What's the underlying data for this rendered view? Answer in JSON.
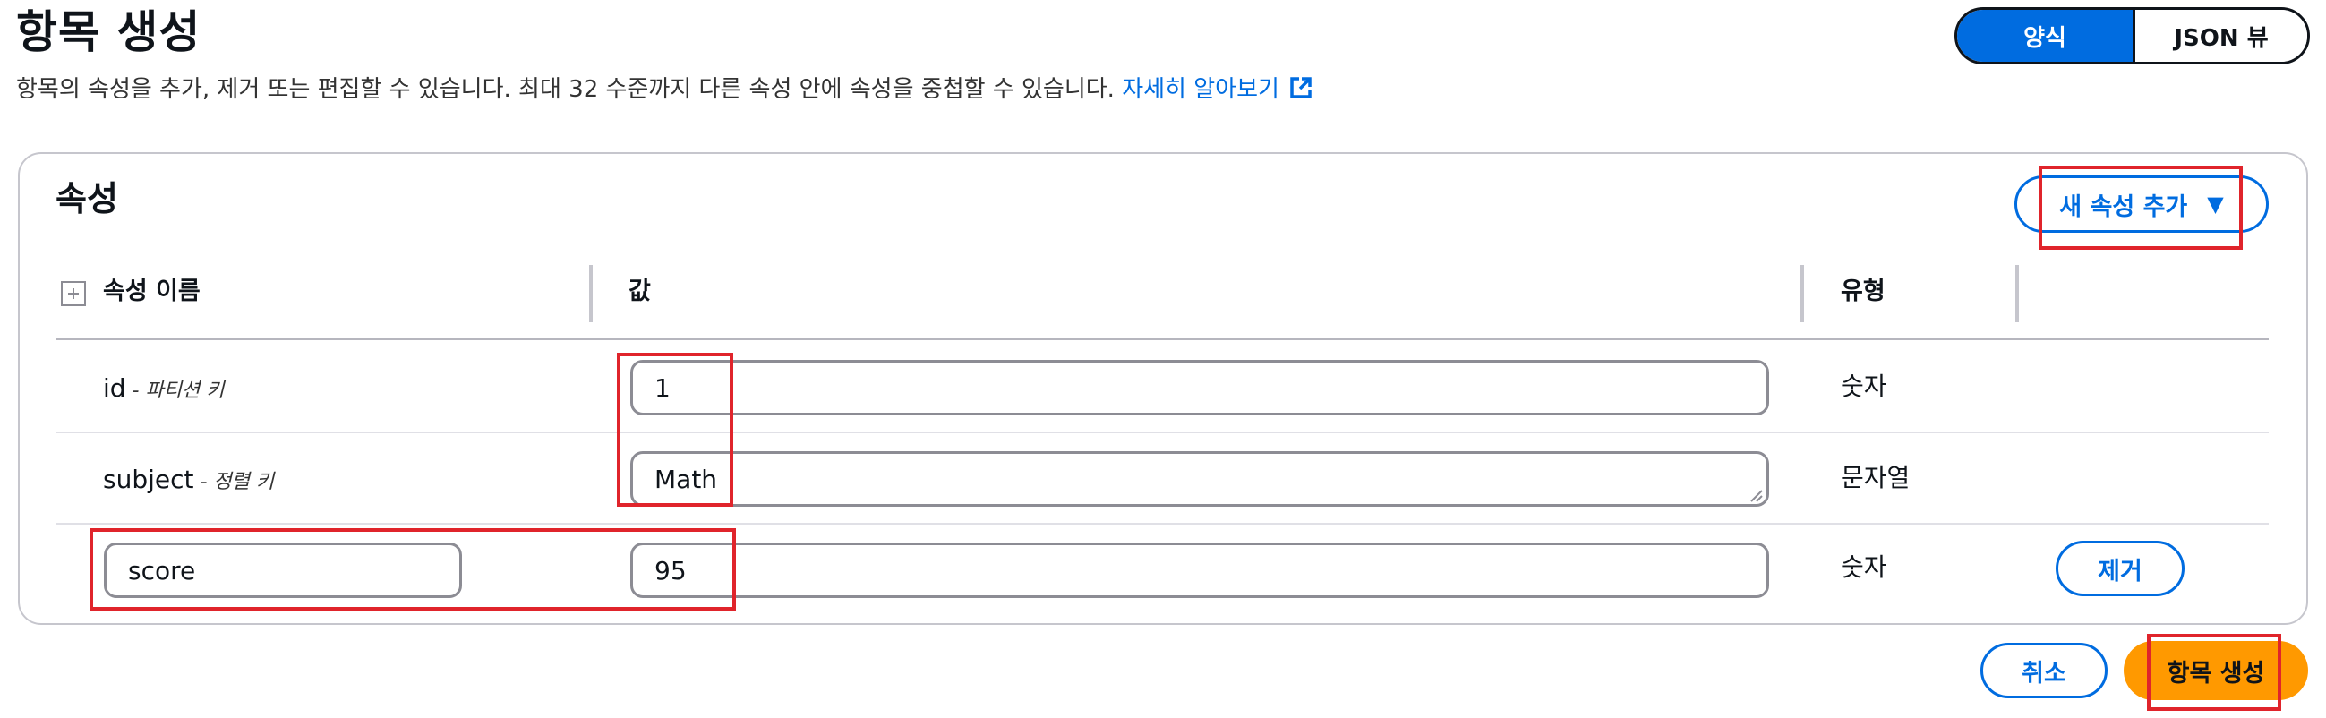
{
  "header": {
    "title": "항목 생성",
    "description": "항목의 속성을 추가, 제거 또는 편집할 수 있습니다. 최대 32 수준까지 다른 속성 안에 속성을 중첩할 수 있습니다.",
    "learn_more": "자세히 알아보기"
  },
  "view_toggle": {
    "form": "양식",
    "json": "JSON 뷰",
    "selected": "양식"
  },
  "attributes": {
    "title": "속성",
    "add_button": "새 속성 추가",
    "columns": {
      "name": "속성 이름",
      "value": "값",
      "type": "유형"
    },
    "rows": [
      {
        "name": "id",
        "role": " - 파티션 키",
        "value": "1",
        "type": "숫자"
      },
      {
        "name": "subject",
        "role": " - 정렬 키",
        "value": "Math",
        "type": "문자열"
      },
      {
        "name": "score",
        "value": "95",
        "type": "숫자",
        "remove": "제거"
      }
    ]
  },
  "footer": {
    "cancel": "취소",
    "create": "항목 생성"
  },
  "colors": {
    "accent": "#006ce0",
    "primary_button": "#ff9900",
    "highlight": "#e0242b"
  },
  "icons": {
    "learn_more": "external-link-icon",
    "add_caret": "caret-down-icon",
    "expand": "expand-all-icon"
  }
}
